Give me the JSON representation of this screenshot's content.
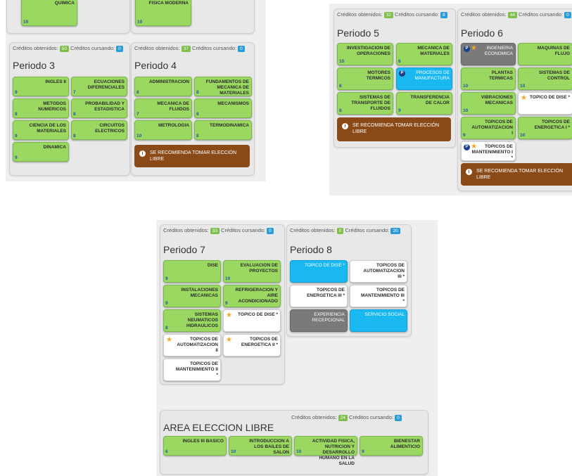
{
  "shots": [
    {
      "top_courses": [
        {
          "name": "QUIMICA",
          "credits": "10"
        },
        {
          "name": "FISICA MODERNA",
          "credits": "10"
        }
      ],
      "periods": [
        {
          "obtained_label": "Créditos obtenidos:",
          "obtained": "50",
          "current_label": "Créditos cursando:",
          "current": "0",
          "title": "Periodo 3",
          "courses": [
            {
              "name": "INGLES II",
              "credits": "9"
            },
            {
              "name": "ECUACIONES DIFERENCIALES",
              "credits": "7"
            },
            {
              "name": "METODOS NUMERICOS",
              "credits": "8"
            },
            {
              "name": "PROBABILIDAD Y ESTADISTICA",
              "credits": "8"
            },
            {
              "name": "CIENCIA DE LOS MATERIALES",
              "credits": "9"
            },
            {
              "name": "CIRCUITOS ELECTRICOS",
              "credits": "8"
            },
            {
              "name": "DINAMICA",
              "credits": "9"
            }
          ]
        },
        {
          "obtained_label": "Créditos obtenidos:",
          "obtained": "37",
          "current_label": "Créditos cursando:",
          "current": "0",
          "title": "Periodo 4",
          "courses": [
            {
              "name": "ADMINISTRACION",
              "credits": "8"
            },
            {
              "name": "FUNDAMENTOS DE MECANICA DE MATERIALES",
              "credits": "8"
            },
            {
              "name": "MECANICA DE FLUIDOS",
              "credits": "7"
            },
            {
              "name": "MECANISMOS",
              "credits": "8"
            },
            {
              "name": "METROLOGIA",
              "credits": "10"
            },
            {
              "name": "TERMODINAMICA",
              "credits": "8"
            }
          ],
          "alert": "SE RECOMIENDA TOMAR ELECCIÓN LIBRE"
        }
      ]
    },
    {
      "periods": [
        {
          "obtained_label": "Créditos obtenidos:",
          "obtained": "32",
          "current_label": "Créditos cursando:",
          "current": "8",
          "title": "Periodo 5",
          "courses": [
            {
              "name": "INVESTIGACION DE OPERACIONES",
              "credits": "10"
            },
            {
              "name": "MECANICA DE MATERIALES",
              "credits": "6"
            },
            {
              "name": "MOTORES TERMICOS",
              "credits": "8"
            },
            {
              "name": "PROCESOS DE MANUFACTURA",
              "credits": "",
              "badge": "P"
            },
            {
              "name": "SISTEMAS DE TRANSPORTE DE FLUIDOS",
              "credits": "8"
            },
            {
              "name": "TRANSFERENCIA DE CALOR",
              "credits": "9"
            }
          ],
          "alert": "SE RECOMIENDA TOMAR ELECCIÓN LIBRE"
        },
        {
          "obtained_label": "Créditos obtenidos:",
          "obtained": "44",
          "current_label": "Créditos cursando:",
          "current": "0",
          "title": "Periodo 6",
          "courses": [
            {
              "name": "INGENIERIA ECONOMICA",
              "credits": "",
              "badge": "P"
            },
            {
              "name": "MAQUINAS DE FLUJO",
              "credits": ""
            },
            {
              "name": "PLANTAS TERMICAS",
              "credits": "10"
            },
            {
              "name": "SISTEMAS DE CONTROL",
              "credits": "10"
            },
            {
              "name": "VIBRACIONES MECANICAS",
              "credits": "10"
            },
            {
              "name": "TOPICO DE DISE *",
              "credits": ""
            },
            {
              "name": "TOPICOS DE AUTOMATIZACION I",
              "credits": "9"
            },
            {
              "name": "TOPICOS DE ENERGETICA I *",
              "credits": "10"
            },
            {
              "name": "TOPICOS DE MANTENIMIENTO I *",
              "credits": "",
              "badge": "P"
            }
          ],
          "alert": "SE RECOMIENDA TOMAR ELECCIÓN LIBRE"
        }
      ]
    },
    {
      "periods": [
        {
          "obtained_label": "Créditos obtenidos:",
          "obtained": "33",
          "current_label": "Créditos cursando:",
          "current": "0",
          "title": "Periodo 7",
          "courses": [
            {
              "name": "DISE",
              "credits": "9"
            },
            {
              "name": "EVALUACION DE PROYECTOS",
              "credits": "10"
            },
            {
              "name": "INSTALACIONES MECANICAS",
              "credits": "9"
            },
            {
              "name": "REFRIGERACION Y AIRE ACONDICIONADO",
              "credits": "9"
            },
            {
              "name": "SISTEMAS NEUMATICOS HIDRAULICOS",
              "credits": "8"
            },
            {
              "name": "TOPICO DE DISE *",
              "credits": ""
            },
            {
              "name": "TOPICOS DE AUTOMATIZACION II",
              "credits": ""
            },
            {
              "name": "TOPICOS DE ENERGETICA II *",
              "credits": ""
            },
            {
              "name": "TOPICOS DE MANTENIMIENTO II *",
              "credits": ""
            }
          ]
        },
        {
          "obtained_label": "Créditos obtenidos:",
          "obtained": "0",
          "current_label": "Créditos cursando:",
          "current": "20",
          "title": "Periodo 8",
          "courses": [
            {
              "name": "TOPICO DE DISE *",
              "credits": ""
            },
            {
              "name": "TOPICOS DE AUTOMATIZACION III *",
              "credits": ""
            },
            {
              "name": "TOPICOS DE ENERGETICA III *",
              "credits": ""
            },
            {
              "name": "TOPICOS DE MANTENIMIENTO III *",
              "credits": ""
            },
            {
              "name": "EXPERIENCIA RECEPCIONAL",
              "credits": ""
            },
            {
              "name": "SERVICIO SOCIAL",
              "credits": ""
            }
          ]
        }
      ],
      "area": {
        "title": "AREA ELECCION LIBRE",
        "obtained_label": "Créditos obtenidos:",
        "obtained": "24",
        "current_label": "Créditos cursando:",
        "current": "0",
        "courses": [
          {
            "name": "INGLES III BASICO",
            "credits": "6"
          },
          {
            "name": "INTRODUCCION A LOS BAILES DE SALON",
            "credits": "10"
          },
          {
            "name": "ACTIVIDAD FISICA, NUTRICION Y DESARROLLO HUMANO EN LA SALUD",
            "credits": "10"
          },
          {
            "name": "BIENESTAR ALIMENTICIO",
            "credits": "9"
          }
        ]
      }
    }
  ],
  "colors": {
    "passed": "#9bd862",
    "current": "#1ab8f0",
    "pending": "#ffffff",
    "blocked": "#7a7a7a",
    "alert": "#8a4a17",
    "star": "#f5a623"
  },
  "icons": {
    "alert": "info-icon",
    "optional": "star-icon",
    "prerequisite": "p-badge-icon"
  }
}
